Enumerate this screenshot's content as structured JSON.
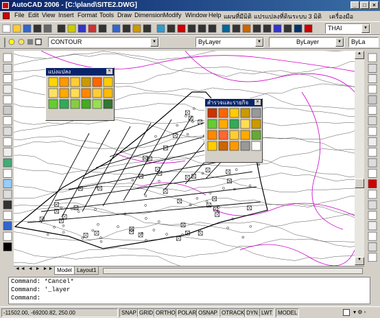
{
  "window": {
    "title": "AutoCAD 2006 - [C:\\pland\\SITE2.DWG]",
    "min": "_",
    "max": "□",
    "close": "×"
  },
  "menu": [
    "File",
    "Edit",
    "View",
    "Insert",
    "Format",
    "Tools",
    "Draw",
    "Dimension",
    "Modify",
    "Window",
    "Help",
    "แผนที่มีมิติ",
    "แปรแปลงที่ดิน",
    "ระบบ 3 มิติ",
    "เครื่องมือ"
  ],
  "toolbar": {
    "font_combo": "THAI",
    "layer_combo": "CONTOUR",
    "color_combo": "ByLayer",
    "linetype_combo": "ByLayer",
    "lineweight_combo": "ByLa"
  },
  "palettes": {
    "left_title": "แบ่งแปลง",
    "right_title": "สำรวจและรายกิจ"
  },
  "tabs": {
    "model": "Model",
    "layout1": "Layout1"
  },
  "command": {
    "line1": "Command: *Cancel*",
    "line2": "Command: '_layer",
    "line3": "Command:"
  },
  "status": {
    "coords": "-11502.00, -69200.82, 250.00",
    "buttons": [
      "SNAP",
      "GRID",
      "ORTHO",
      "POLAR",
      "OSNAP",
      "OTRACK",
      "DYN",
      "LWT",
      "MODEL"
    ]
  },
  "colors": {
    "title_bar": "#0a246a",
    "contour_main": "#000000",
    "contour_magenta": "#cc00cc",
    "canvas": "#ffffff"
  }
}
